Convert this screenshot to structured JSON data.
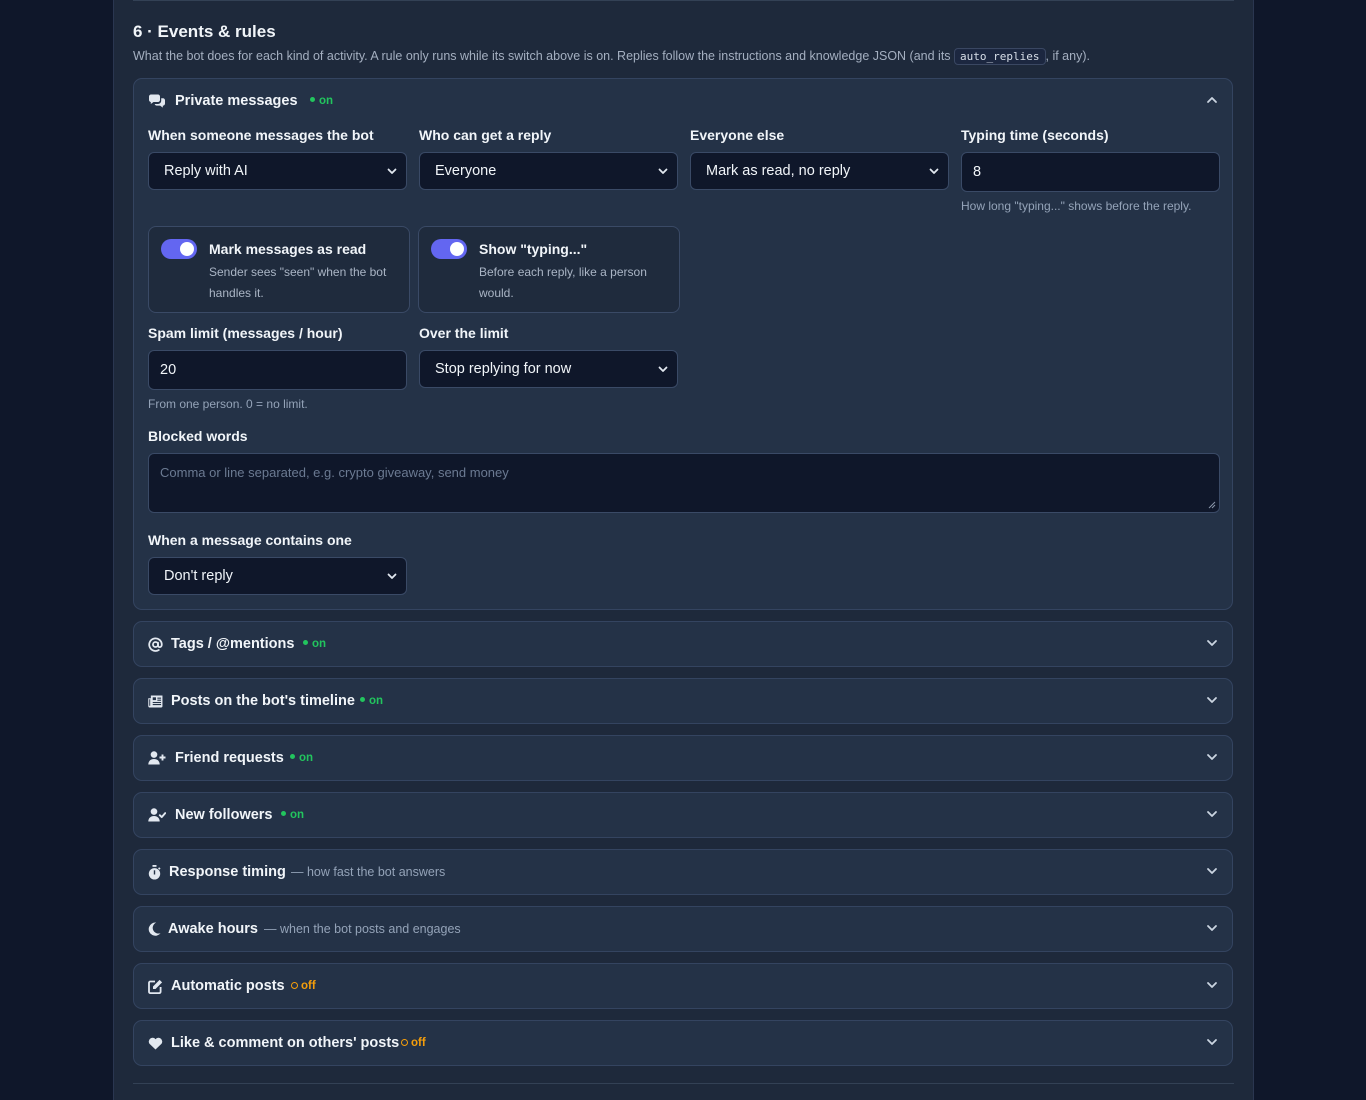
{
  "section": {
    "title": "6 · Events & rules",
    "description_before": "What the bot does for each kind of activity. A rule only runs while its switch above is on. Replies follow the instructions and knowledge JSON (and its ",
    "description_code": "auto_replies",
    "description_after": ", if any)."
  },
  "private_messages": {
    "title": "Private messages",
    "status": "on",
    "icon": "comments-icon",
    "fields": {
      "when_label": "When someone messages the bot",
      "when_value": "Reply with AI",
      "who_label": "Who can get a reply",
      "who_value": "Everyone",
      "else_label": "Everyone else",
      "else_value": "Mark as read, no reply",
      "typing_label": "Typing time (seconds)",
      "typing_value": "8",
      "typing_hint": "How long \"typing...\" shows before the reply."
    },
    "toggles": {
      "mark_read_title": "Mark messages as read",
      "mark_read_desc": "Sender sees \"seen\" when the bot handles it.",
      "show_typing_title": "Show \"typing...\"",
      "show_typing_desc": "Before each reply, like a person would."
    },
    "spam": {
      "limit_label": "Spam limit (messages / hour)",
      "limit_value": "20",
      "limit_hint": "From one person. 0 = no limit.",
      "over_label": "Over the limit",
      "over_value": "Stop replying for now"
    },
    "blocked": {
      "label": "Blocked words",
      "placeholder": "Comma or line separated, e.g. crypto giveaway, send money",
      "contains_label": "When a message contains one",
      "contains_value": "Don't reply"
    }
  },
  "accordions": [
    {
      "title": "Tags / @mentions",
      "status": "on",
      "icon": "at-icon"
    },
    {
      "title": "Posts on the bot's timeline",
      "status": "on",
      "icon": "newspaper-icon"
    },
    {
      "title": "Friend requests",
      "status": "on",
      "icon": "user-plus-icon"
    },
    {
      "title": "New followers",
      "status": "on",
      "icon": "user-check-icon"
    },
    {
      "title": "Response timing",
      "subtitle": "— how fast the bot answers",
      "icon": "stopwatch-icon"
    },
    {
      "title": "Awake hours",
      "subtitle": "— when the bot posts and engages",
      "icon": "moon-icon"
    },
    {
      "title": "Automatic posts",
      "status": "off",
      "icon": "edit-icon"
    },
    {
      "title": "Like & comment on others' posts",
      "status": "off",
      "icon": "heart-icon"
    }
  ],
  "colors": {
    "background": "#0f172a",
    "panel": "#1e293b",
    "card": "#243247",
    "accent": "#6366f1",
    "status_on": "#22c55e",
    "status_off": "#f59e0b"
  }
}
